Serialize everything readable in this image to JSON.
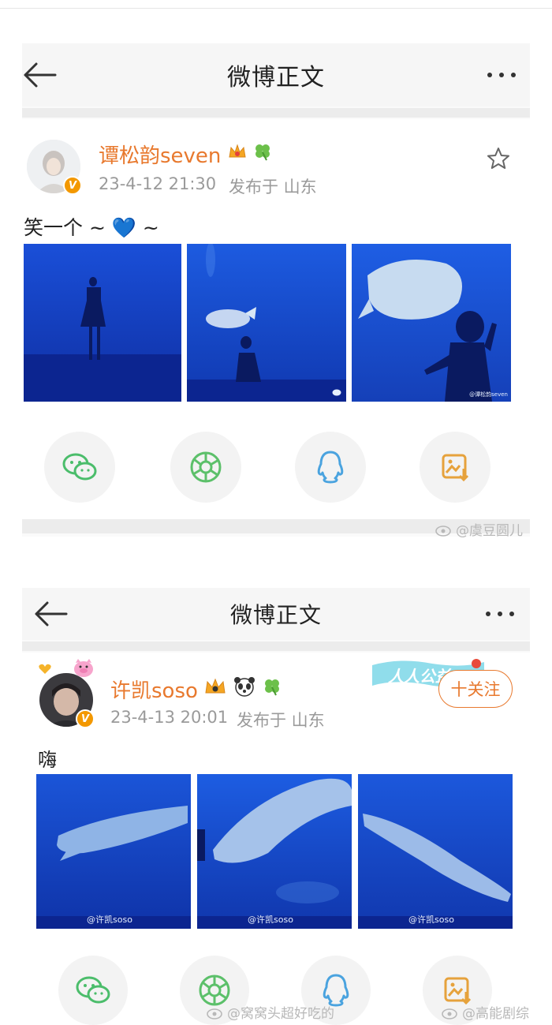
{
  "nav": {
    "title": "微博正文"
  },
  "post1": {
    "username": "谭松韵seven",
    "timestamp": "23-4-12 21:30",
    "location": "发布于 山东",
    "content": "笑一个 ~ 💙 ~",
    "verified_badge": "V",
    "photo_watermark": "@谭松韵seven"
  },
  "post2": {
    "username": "许凯soso",
    "timestamp": "23-4-13 20:01",
    "location": "发布于 山东",
    "content": "嗨",
    "verified_badge": "V",
    "follow_label": "十关注",
    "banner_text": "人人公益",
    "photo_watermark": "@许凯soso"
  },
  "share": {
    "icons": [
      "wechat-icon",
      "moments-icon",
      "qq-icon",
      "save-image-icon"
    ]
  },
  "watermarks": {
    "mid_right": "@虞豆圆儿",
    "bottom_left": "@窝窝头超好吃的",
    "bottom_right": "@高能剧综"
  },
  "colors": {
    "username": "#e8792e",
    "meta": "#9a9a9a",
    "wechat": "#4bbd6b",
    "qq": "#4aa3df",
    "save": "#e6a23c",
    "aquarium": "#1845c8"
  }
}
